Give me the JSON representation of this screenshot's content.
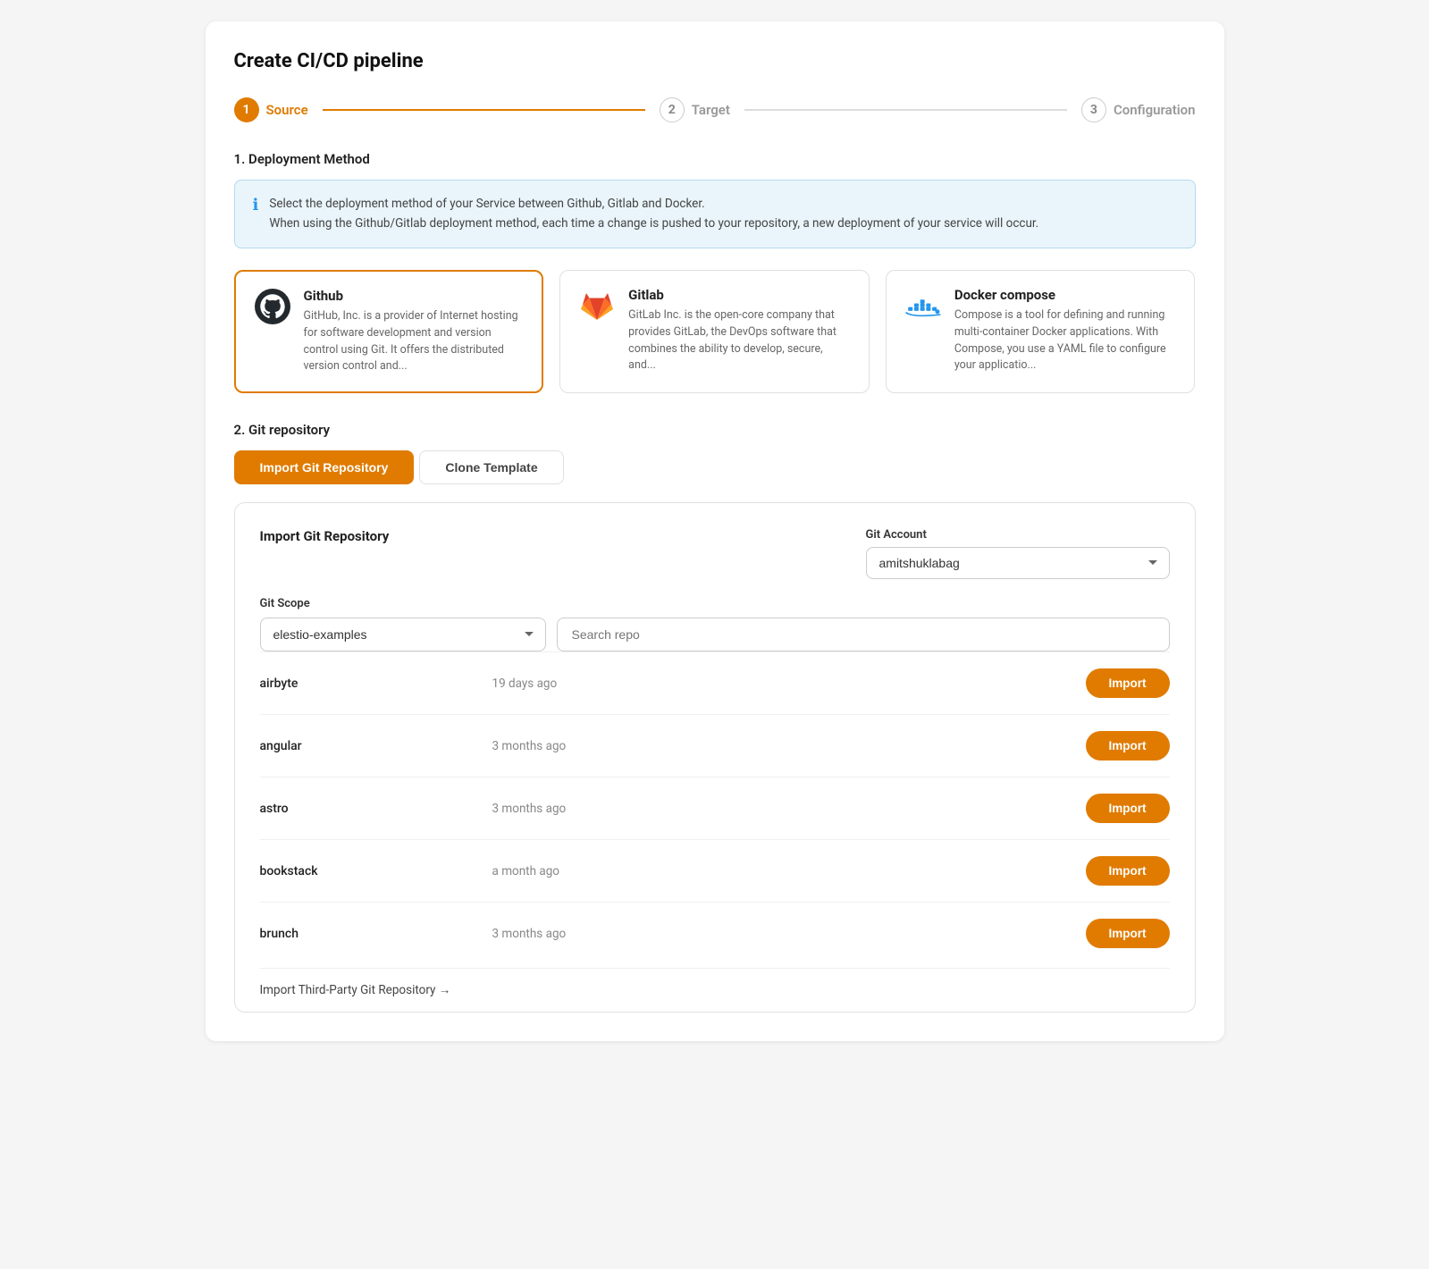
{
  "page": {
    "title": "Create CI/CD pipeline"
  },
  "stepper": {
    "steps": [
      {
        "number": "1",
        "label": "Source",
        "state": "active"
      },
      {
        "number": "2",
        "label": "Target",
        "state": "inactive"
      },
      {
        "number": "3",
        "label": "Configuration",
        "state": "inactive"
      }
    ]
  },
  "deployment_method": {
    "section_label": "1. Deployment Method",
    "info_text_line1": "Select the deployment method of your Service between Github, Gitlab and Docker.",
    "info_text_line2": "When using the Github/Gitlab deployment method, each time a change is pushed to your repository, a new deployment of your service will occur.",
    "methods": [
      {
        "id": "github",
        "name": "Github",
        "description": "GitHub, Inc. is a provider of Internet hosting for software development and version control using Git. It offers the distributed version control and...",
        "selected": true
      },
      {
        "id": "gitlab",
        "name": "Gitlab",
        "description": "GitLab Inc. is the open-core company that provides GitLab, the DevOps software that combines the ability to develop, secure, and...",
        "selected": false
      },
      {
        "id": "docker",
        "name": "Docker compose",
        "description": "Compose is a tool for defining and running multi-container Docker applications. With Compose, you use a YAML file to configure your applicatio...",
        "selected": false
      }
    ]
  },
  "git_repository": {
    "section_label": "2. Git repository",
    "tabs": [
      {
        "id": "import",
        "label": "Import Git Repository",
        "active": true
      },
      {
        "id": "clone",
        "label": "Clone Template",
        "active": false
      }
    ],
    "panel": {
      "title": "Import Git Repository",
      "git_account_label": "Git Account",
      "git_account_value": "amitshuklabag",
      "git_scope_label": "Git Scope",
      "git_scope_value": "elestio-examples",
      "search_placeholder": "Search repo",
      "repos": [
        {
          "name": "airbyte",
          "time": "19 days ago"
        },
        {
          "name": "angular",
          "time": "3 months ago"
        },
        {
          "name": "astro",
          "time": "3 months ago"
        },
        {
          "name": "bookstack",
          "time": "a month ago"
        },
        {
          "name": "brunch",
          "time": "3 months ago"
        }
      ],
      "import_button_label": "Import",
      "footer_link": "Import Third-Party Git Repository →"
    }
  }
}
